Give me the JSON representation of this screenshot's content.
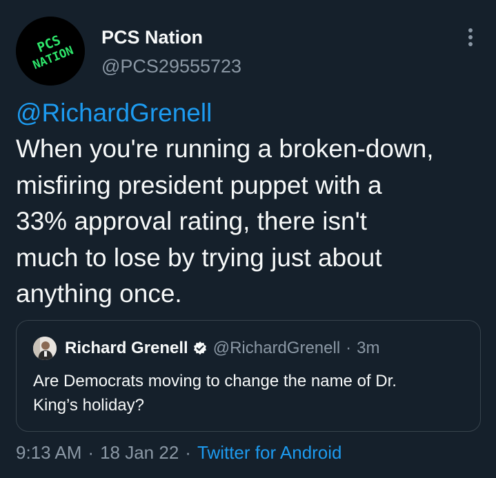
{
  "author": {
    "name": "PCS Nation",
    "handle": "@PCS29555723",
    "avatar_text_line1": "PCS",
    "avatar_text_line2": "NATION"
  },
  "tweet": {
    "mention": "@RichardGrenell",
    "lines": [
      "When you're running a broken-down,",
      "misfiring president puppet with a",
      "33% approval rating, there isn't",
      "much to lose by trying just about",
      "anything once."
    ]
  },
  "quote": {
    "name": "Richard Grenell",
    "handle": "@RichardGrenell",
    "separator": "·",
    "time": "3m",
    "lines": [
      "Are Democrats moving to change the name of Dr.",
      "King’s holiday?"
    ]
  },
  "meta": {
    "time": "9:13 AM",
    "separator": "·",
    "date": "18 Jan 22",
    "source": "Twitter for Android"
  },
  "colors": {
    "background": "#15202b",
    "text": "#f7f9f9",
    "muted": "#8b98a5",
    "link": "#1d9bf0",
    "avatar_lettering": "#2ee66b",
    "border": "#38444d"
  },
  "icons": {
    "more": "more-vertical-icon",
    "verified": "verified-badge-icon"
  }
}
